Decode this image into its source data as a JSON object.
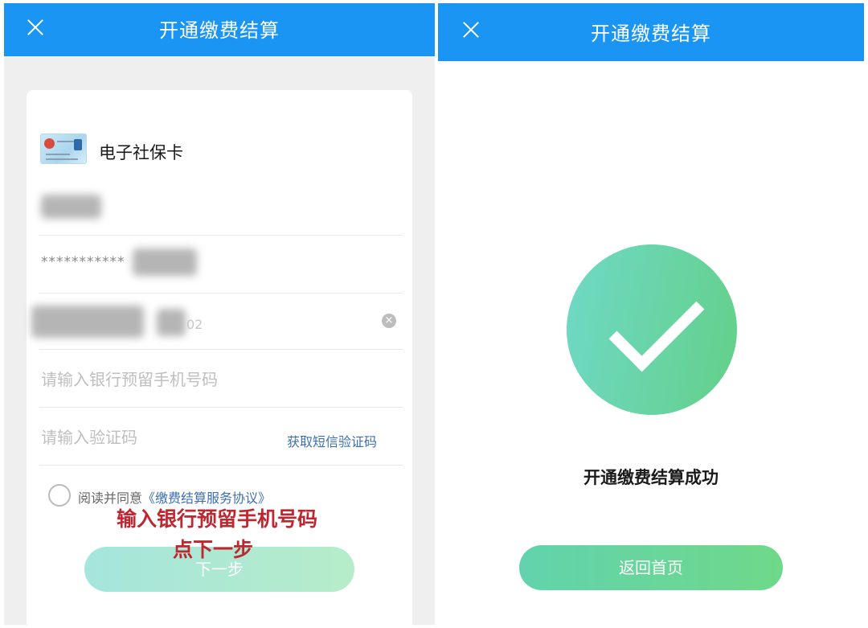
{
  "left_screen": {
    "title": "开通缴费结算",
    "card_label": "电子社保卡",
    "masked_id": "***********",
    "field_tail": "02",
    "clear_icon": "clear-circle-icon",
    "phone_placeholder": "请输入银行预留手机号码",
    "code_placeholder": "请输入验证码",
    "sms_link": "获取短信验证码",
    "agree_prefix": "阅读并同意",
    "agree_link": "《缴费结算服务协议》",
    "annotation_line1": "输入银行预留手机号码",
    "annotation_line2": "点下一步",
    "next_button": "下一步"
  },
  "right_screen": {
    "title": "开通缴费结算",
    "success_message": "开通缴费结算成功",
    "home_button": "返回首页",
    "success_icon": "check-icon"
  },
  "colors": {
    "nav_blue": "#1b95f3",
    "link_blue": "#3c6fb1",
    "annotation_red": "#c0262f",
    "success_green": "#63d089"
  }
}
